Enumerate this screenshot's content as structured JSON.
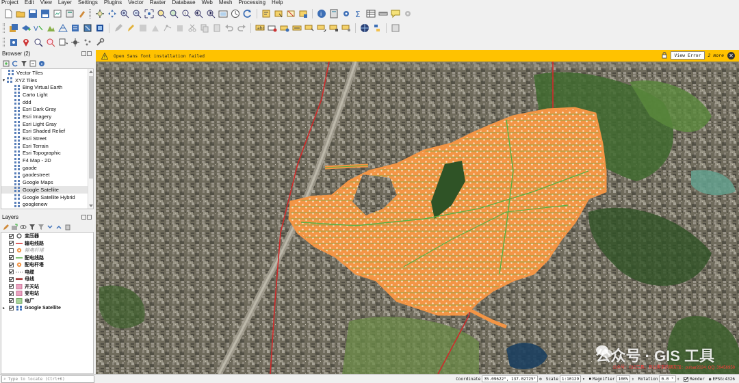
{
  "menu": [
    "Project",
    "Edit",
    "View",
    "Layer",
    "Settings",
    "Plugins",
    "Vector",
    "Raster",
    "Database",
    "Web",
    "Mesh",
    "Processing",
    "Help"
  ],
  "browser": {
    "title": "Browser (2)",
    "items": [
      {
        "label": "Vector Tiles",
        "indent": 1
      },
      {
        "label": "XYZ Tiles",
        "indent": 0,
        "expanded": true
      },
      {
        "label": "Bing Virtual Earth",
        "indent": 2
      },
      {
        "label": "Carto Light",
        "indent": 2
      },
      {
        "label": "ddd",
        "indent": 2
      },
      {
        "label": "Esri Dark Gray",
        "indent": 2
      },
      {
        "label": "Esri Imagery",
        "indent": 2
      },
      {
        "label": "Esri Light Gray",
        "indent": 2
      },
      {
        "label": "Esri Shaded Relief",
        "indent": 2
      },
      {
        "label": "Esri Street",
        "indent": 2
      },
      {
        "label": "Esri Terrain",
        "indent": 2
      },
      {
        "label": "Esri Topographic",
        "indent": 2
      },
      {
        "label": "F4 Map - 2D",
        "indent": 2
      },
      {
        "label": "gaode",
        "indent": 2
      },
      {
        "label": "gaodestreet",
        "indent": 2
      },
      {
        "label": "Google Maps",
        "indent": 2
      },
      {
        "label": "Google Satellite",
        "indent": 2,
        "selected": true
      },
      {
        "label": "Google Satellite Hybrid",
        "indent": 2
      },
      {
        "label": "googlenew",
        "indent": 2
      }
    ]
  },
  "layers": {
    "title": "Layers",
    "items": [
      {
        "label": "变压器",
        "checked": true,
        "symbol": "circle-outline"
      },
      {
        "label": "输电线路",
        "checked": true,
        "symbol": "line-red"
      },
      {
        "label": "输电杆塔",
        "checked": false,
        "symbol": "dot-orange",
        "dim": true
      },
      {
        "label": "配电线路",
        "checked": true,
        "symbol": "line-green"
      },
      {
        "label": "配电杆塔",
        "checked": true,
        "symbol": "dot-orange"
      },
      {
        "label": "电缆",
        "checked": true,
        "symbol": "line-dashed"
      },
      {
        "label": "母线",
        "checked": true,
        "symbol": "line-darkred"
      },
      {
        "label": "开关站",
        "checked": true,
        "symbol": "fill-pink"
      },
      {
        "label": "变电站",
        "checked": true,
        "symbol": "fill-pink"
      },
      {
        "label": "电厂",
        "checked": true,
        "symbol": "fill-green"
      },
      {
        "label": "Google Satellite",
        "checked": true,
        "symbol": "group",
        "group": true
      }
    ]
  },
  "message_bar": {
    "text": "Open Sans font installation failed",
    "button": "View Error",
    "more": "2 more"
  },
  "map": {
    "watermark": "公众号 · GIS 工具",
    "watermark_red": "公众号：GIS工具，有此需求的朋友加：pulsar2024; QQ: 39456958"
  },
  "status": {
    "locator_placeholder": "Type to locate (Ctrl+K)",
    "coordinate_label": "Coordinate",
    "coordinate": "35.09622°, 137.02725°",
    "scale_label": "Scale",
    "scale": "1:10129",
    "magnifier_label": "Magnifier",
    "magnifier": "100%",
    "rotation_label": "Rotation",
    "rotation": "0.0 °",
    "render_label": "Render",
    "crs": "EPSG:4326"
  },
  "colors": {
    "message_bar": "#ffc200",
    "network_orange": "#f39545",
    "network_green": "#57b043",
    "transmission_red": "#d02a2a"
  }
}
